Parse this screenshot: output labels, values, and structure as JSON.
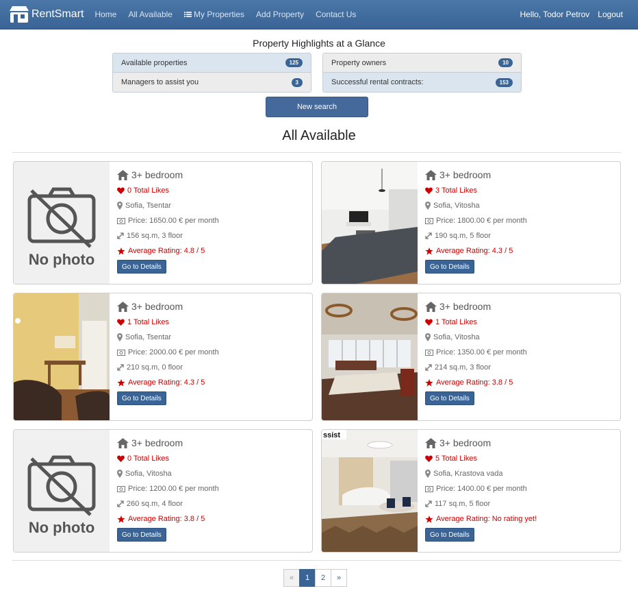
{
  "navbar": {
    "brand": "RentSmart",
    "links": [
      "Home",
      "All Available",
      "My Properties",
      "Add Property",
      "Contact Us"
    ],
    "greeting": "Hello, Todor Petrov",
    "logout": "Logout"
  },
  "highlights": {
    "title": "Property Highlights at a Glance",
    "available_label": "Available properties",
    "available_count": "125",
    "managers_label": "Managers to assist you",
    "managers_count": "3",
    "owners_label": "Property owners",
    "owners_count": "10",
    "contracts_label": "Successful rental contracts:",
    "contracts_count": "153",
    "new_search": "New search"
  },
  "section_title": "All Available",
  "no_photo_text": "No photo",
  "details_label": "Go to Details",
  "cards": [
    {
      "title": "3+ bedroom",
      "likes": "0 Total Likes",
      "location": "Sofia, Tsentar",
      "price": "Price: 1650.00 € per month",
      "size": "156 sq.m, 3 floor",
      "rating": "Average Rating: 4.8 / 5",
      "image": "no-photo"
    },
    {
      "title": "3+ bedroom",
      "likes": "3 Total Likes",
      "location": "Sofia, Vitosha",
      "price": "Price: 1800.00 € per month",
      "size": "190 sq.m, 5 floor",
      "rating": "Average Rating: 4.3 / 5",
      "image": "living-room"
    },
    {
      "title": "3+ bedroom",
      "likes": "1 Total Likes",
      "location": "Sofia, Tsentar",
      "price": "Price: 2000.00 € per month",
      "size": "210 sq.m, 0 floor",
      "rating": "Average Rating: 4.3 / 5",
      "image": "dining-room"
    },
    {
      "title": "3+ bedroom",
      "likes": "1 Total Likes",
      "location": "Sofia, Vitosha",
      "price": "Price: 1350.00 € per month",
      "size": "214 sq.m, 3 floor",
      "rating": "Average Rating: 3.8 / 5",
      "image": "luxury-hall"
    },
    {
      "title": "3+ bedroom",
      "likes": "0 Total Likes",
      "location": "Sofia, Vitosha",
      "price": "Price: 1200.00 € per month",
      "size": "260 sq.m, 4 floor",
      "rating": "Average Rating: 3.8 / 5",
      "image": "no-photo"
    },
    {
      "title": "3+ bedroom",
      "likes": "5 Total Likes",
      "location": "Sofia, Krastova vada",
      "price": "Price: 1400.00 € per month",
      "size": "117 sq.m, 5 floor",
      "rating": "Average Rating: No rating yet!",
      "image": "modern-lounge",
      "watermark": "ssist"
    }
  ],
  "pagination": {
    "prev": "«",
    "pages": [
      "1",
      "2"
    ],
    "next": "»",
    "active": "1"
  },
  "colors": {
    "primary": "#3a6496",
    "accent_red": "#c00000",
    "navbar": "#4a76a8"
  }
}
